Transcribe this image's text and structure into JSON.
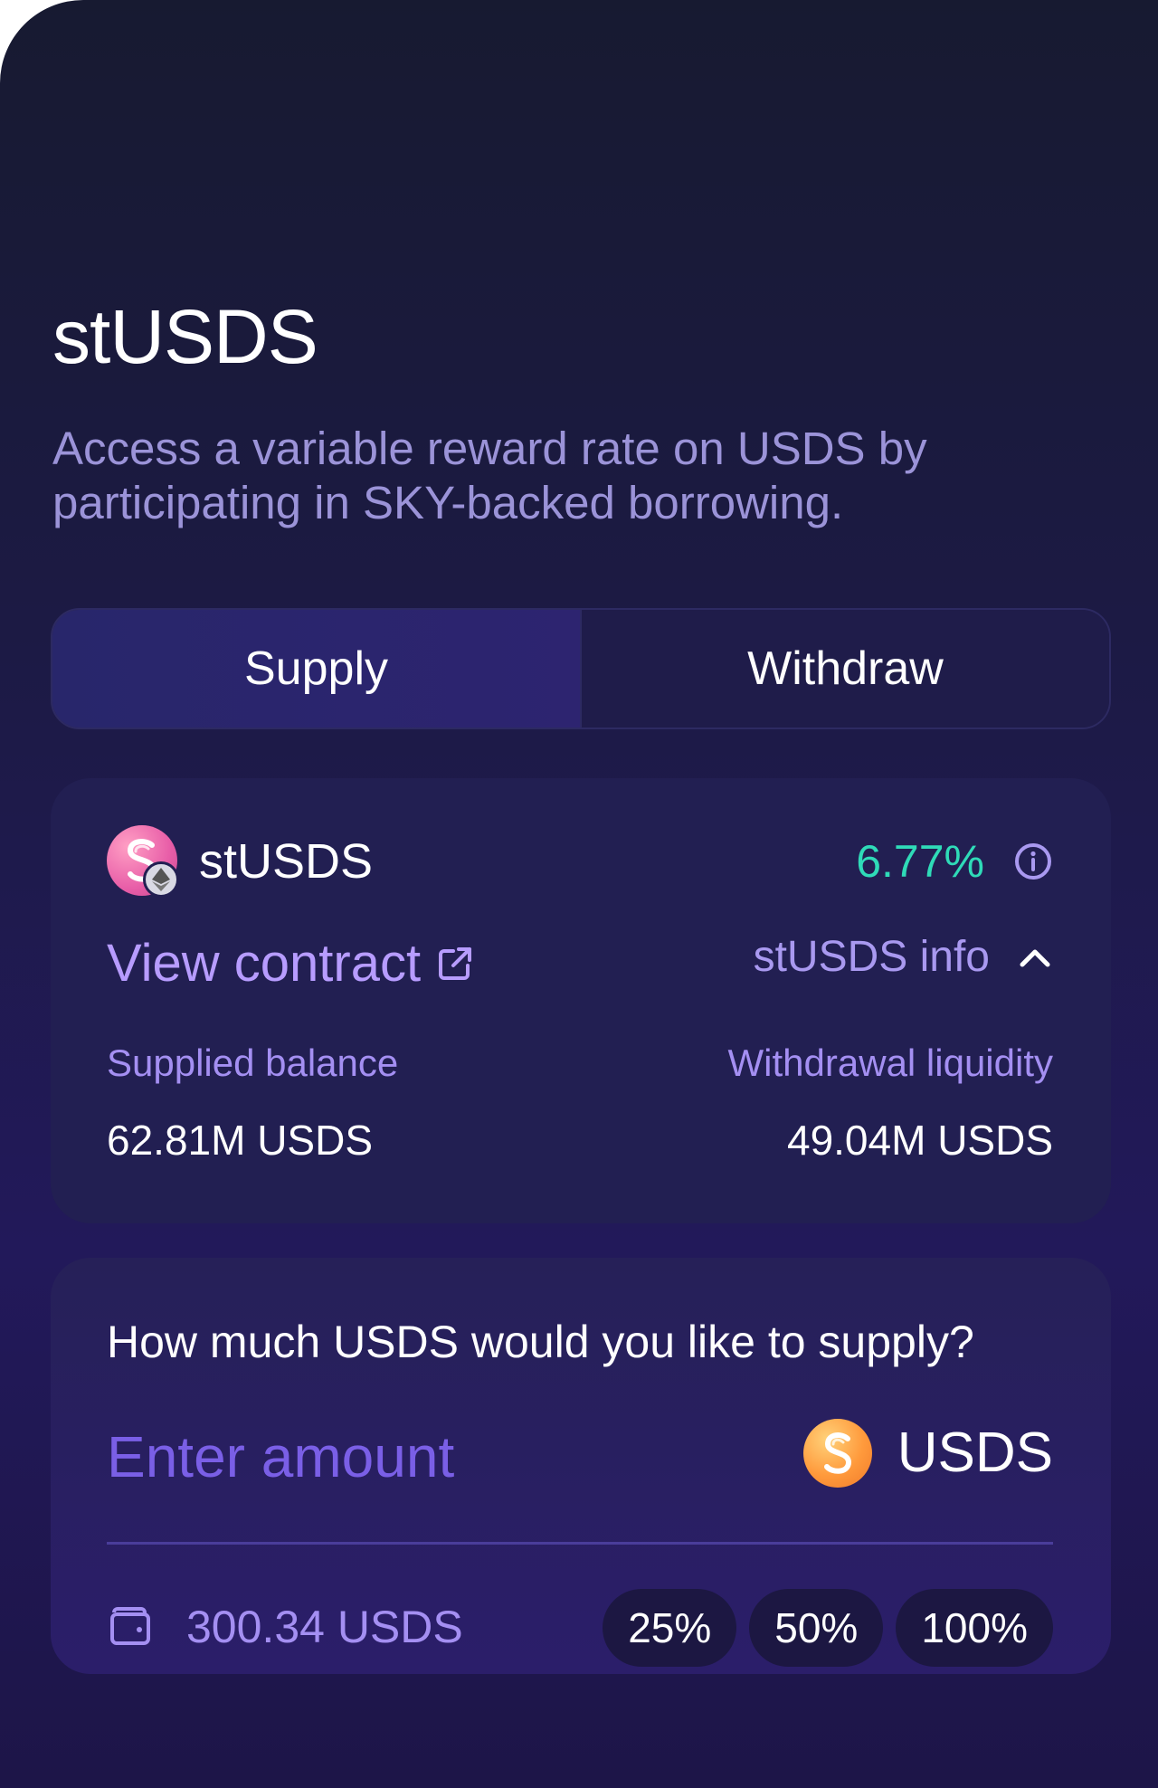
{
  "page": {
    "title": "stUSDS",
    "description": "Access a variable reward rate on USDS by participating in SKY-backed borrowing."
  },
  "tabs": [
    {
      "label": "Supply",
      "active": true
    },
    {
      "label": "Withdraw",
      "active": false
    }
  ],
  "info_card": {
    "token_name": "stUSDS",
    "token_icon": "stusds-logo",
    "network_icon": "ethereum-icon",
    "rate": "6.77%",
    "view_contract_label": "View contract",
    "info_toggle_label": "stUSDS info",
    "supplied_balance_label": "Supplied balance",
    "supplied_balance_value": "62.81M USDS",
    "withdrawal_liquidity_label": "Withdrawal liquidity",
    "withdrawal_liquidity_value": "49.04M USDS"
  },
  "supply_card": {
    "question": "How much USDS would you like to supply?",
    "amount_placeholder": "Enter amount",
    "amount_value": "",
    "asset_name": "USDS",
    "asset_icon": "usds-logo",
    "wallet_balance": "300.34 USDS",
    "percent_buttons": [
      "25%",
      "50%",
      "100%"
    ]
  },
  "colors": {
    "accent_green": "#2fdbb8",
    "accent_purple": "#b79cff",
    "label_purple": "#a48ff2"
  }
}
